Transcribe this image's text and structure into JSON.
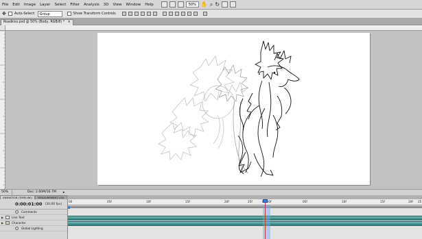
{
  "menu": [
    "File",
    "Edit",
    "Image",
    "Layer",
    "Select",
    "Filter",
    "Analysis",
    "3D",
    "View",
    "Window",
    "Help"
  ],
  "menu_zoom": "50%",
  "options": {
    "auto_select_label": "Auto-Select:",
    "auto_select_value": "Group",
    "show_transform_label": "Show Transform Controls"
  },
  "document": {
    "tab_title": "Roadkiss.psd @ 50% (Body, RGB/8) *"
  },
  "status": {
    "zoom": "50%",
    "doc_size": "Doc: 2.60M/16.7M"
  },
  "animation": {
    "tabs": [
      "ANIMATION (TIMELINE)",
      "MEASUREMENT LOG"
    ],
    "timecode": "0:00:01:00",
    "fps": "(30.00 fps)",
    "ruler_labels": [
      "00",
      "05f",
      "10f",
      "15f",
      "20f",
      "25f",
      "01:00f",
      "05f",
      "10f",
      "15f",
      "20f",
      "25"
    ],
    "layers": [
      {
        "name": "Comments",
        "type": "stopwatch"
      },
      {
        "name": "Line Text",
        "type": "layer"
      },
      {
        "name": "Character",
        "type": "group"
      },
      {
        "name": "Global Lighting",
        "type": "stopwatch"
      }
    ]
  }
}
